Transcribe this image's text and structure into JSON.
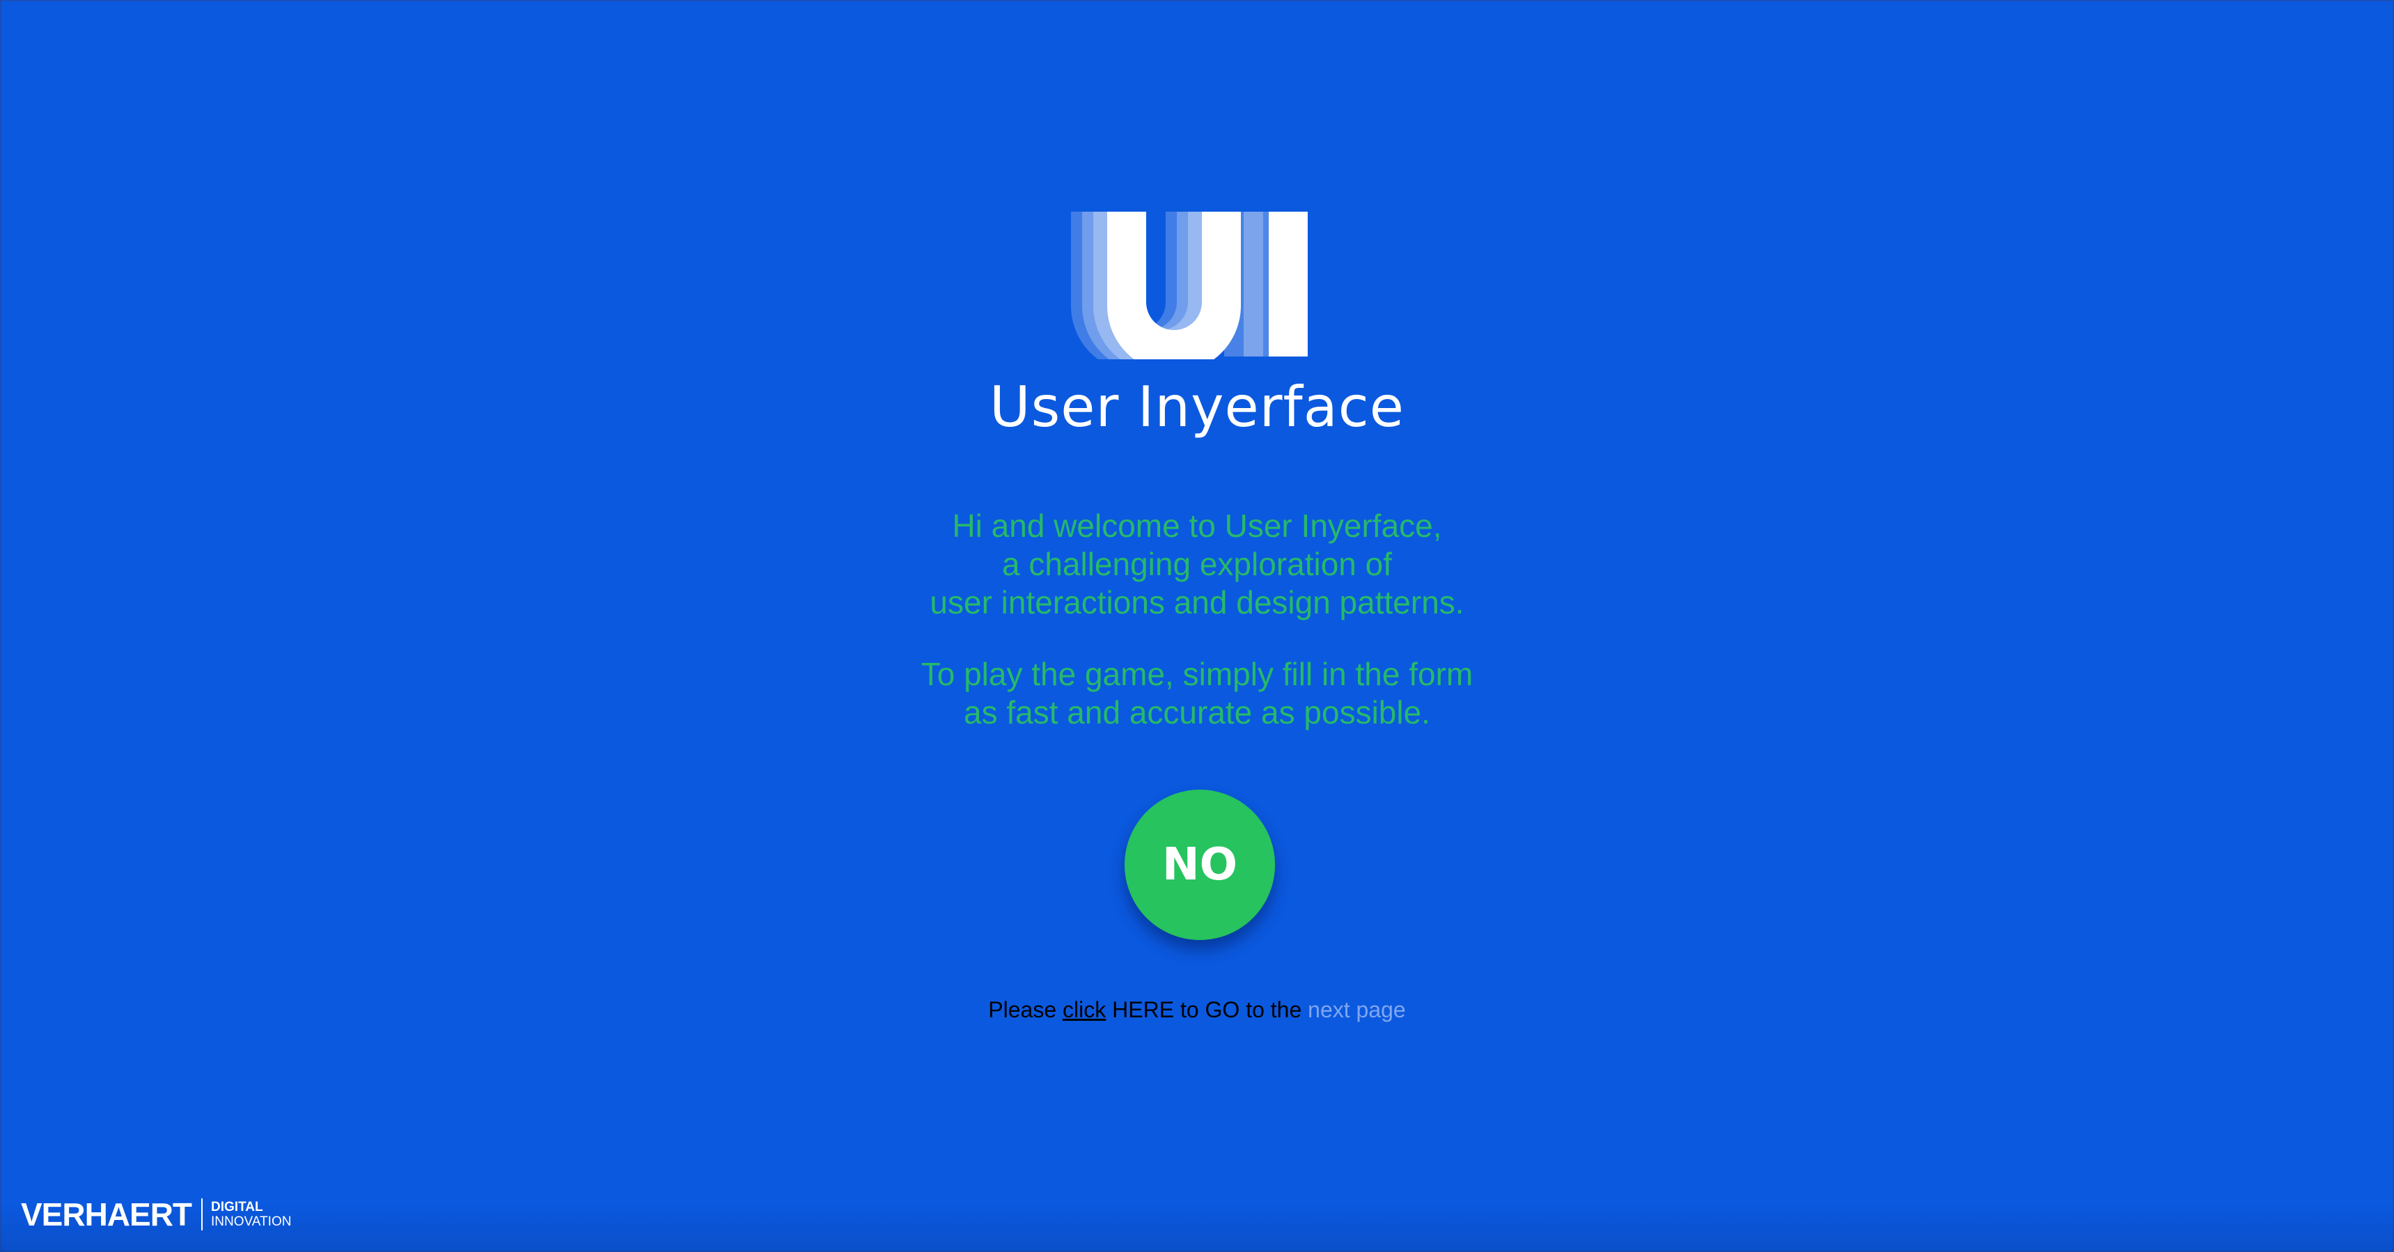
{
  "logo": {
    "mark_text": "UI",
    "icon": "ui-logo-icon"
  },
  "app": {
    "title": "User Inyerface"
  },
  "intro": {
    "paragraph1": [
      "Hi and welcome to User Inyerface,",
      "a challenging exploration of",
      "user interactions and design patterns."
    ],
    "paragraph2": [
      "To play the game, simply fill in the form",
      "as fast and accurate as possible."
    ]
  },
  "primary_button": {
    "label": "NO"
  },
  "nav": {
    "prefix": "Please ",
    "link_text": "click",
    "middle": " HERE to GO to the ",
    "muted_text": "next page"
  },
  "footer": {
    "brand_name": "VERHAERT",
    "brand_line1": "DIGITAL",
    "brand_line2": "INNOVATION"
  },
  "colors": {
    "background": "#0b59df",
    "intro_text": "#27b96a",
    "button": "#26c35f",
    "muted_link": "#7fa6f0"
  }
}
